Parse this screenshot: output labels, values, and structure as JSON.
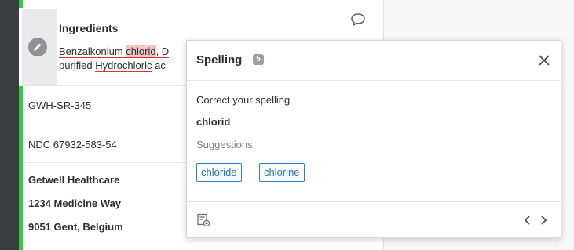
{
  "ingredients": {
    "title": "Ingredients",
    "line1_part1": "Benzalkonium ",
    "line1_error": "chlorid",
    "line1_part2": ", D",
    "line2_part1": "purified ",
    "line2_underlined": "Hydrochloric",
    "line2_part2": " ac"
  },
  "rows": {
    "code": "GWH-SR-345",
    "ndc": "NDC 67932-583-54",
    "company": "Getwell Healthcare",
    "street": "1234 Medicine Way",
    "city": "9051 Gent, Belgium"
  },
  "spelling_popover": {
    "title": "Spelling",
    "badge_count": "5",
    "prompt": "Correct your spelling",
    "word": "chlorid",
    "suggestions_label": "Suggestions:",
    "suggestions": [
      "chloride",
      "chlorine"
    ]
  },
  "icons": {
    "edit": "pencil-icon",
    "comment": "comment-icon",
    "close": "close-icon",
    "add": "add-note-icon",
    "prev": "chevron-left-icon",
    "next": "chevron-right-icon"
  },
  "colors": {
    "status_green": "#2ecc40",
    "error_highlight": "#f6c6c6",
    "suggestion_blue": "#1f6fc1"
  }
}
